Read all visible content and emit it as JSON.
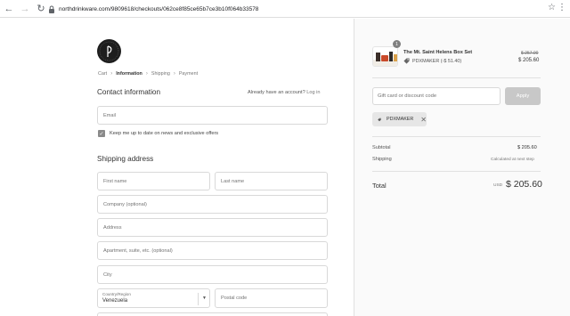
{
  "browser": {
    "url": "northdrinkware.com/9809618/checkouts/062ce8f85ce65b7ce3b10f064b33578"
  },
  "breadcrumb": {
    "items": [
      "Cart",
      "Information",
      "Shipping",
      "Payment"
    ]
  },
  "contact": {
    "title": "Contact information",
    "login_prompt": "Already have an account?",
    "login_link": "Log in",
    "email_placeholder": "Email",
    "newsletter_label": "Keep me up to date on news and exclusive offers"
  },
  "shipping": {
    "title": "Shipping address",
    "first_name_placeholder": "First name",
    "last_name_placeholder": "Last name",
    "company_placeholder": "Company (optional)",
    "address_placeholder": "Address",
    "apartment_placeholder": "Apartment, suite, etc. (optional)",
    "city_placeholder": "City",
    "country_label": "Country/Region",
    "country_value": "Venezuela",
    "postal_placeholder": "Postal code"
  },
  "order": {
    "quantity": "1",
    "product_name": "The Mt. Saint Helens Box Set",
    "product_discount": "PDXMAKER (-$ 51.40)",
    "original_price": "$ 257.00",
    "price": "$ 205.60",
    "discount_placeholder": "Gift card or discount code",
    "apply_label": "Apply",
    "applied_code": "PDXMAKER",
    "subtotal_label": "Subtotal",
    "subtotal_value": "$ 205.60",
    "shipping_label": "Shipping",
    "shipping_value": "Calculated at next step",
    "total_label": "Total",
    "total_currency": "USD",
    "total_value": "$ 205.60"
  },
  "colors": {
    "accent": "#8a8a8a",
    "panel_bg": "#fafafa",
    "apply_disabled": "#c8c8c8"
  }
}
